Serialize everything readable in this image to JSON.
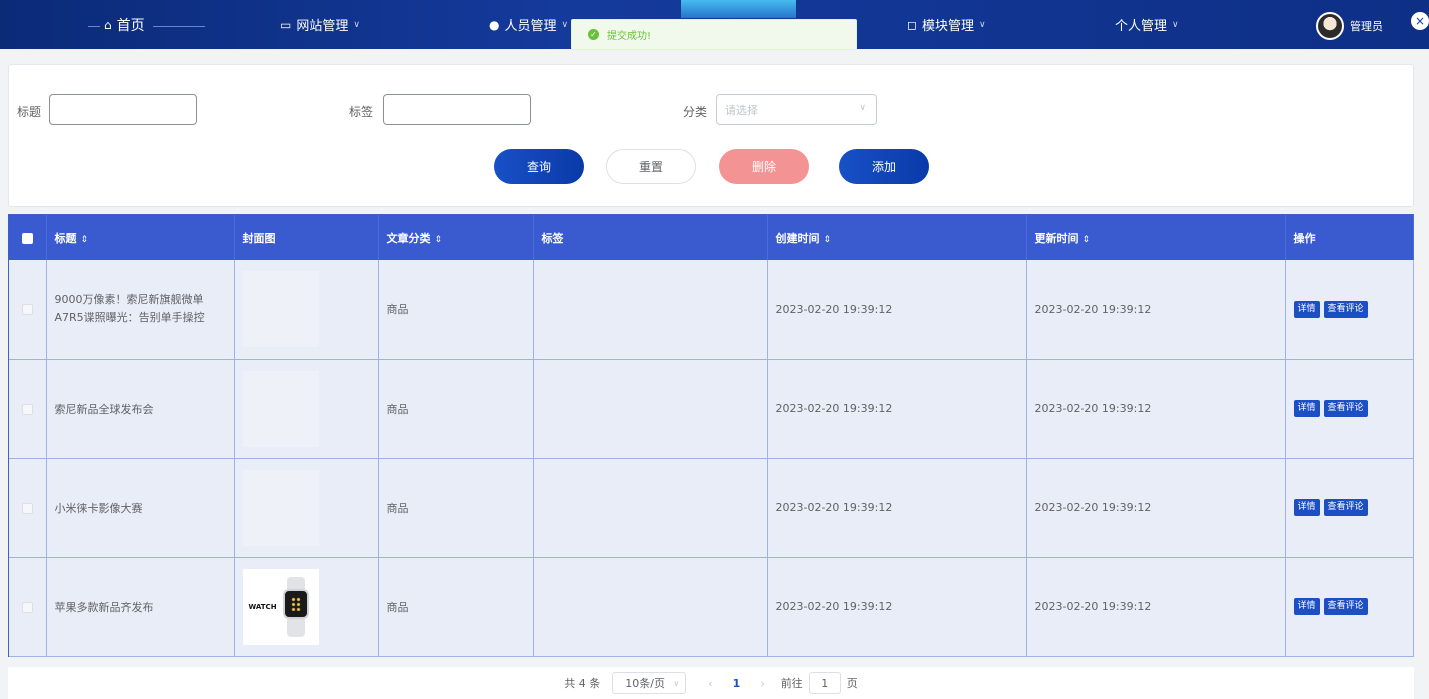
{
  "nav": {
    "home": "首页",
    "site_mgmt": "网站管理",
    "user_mgmt": "人员管理",
    "module_mgmt": "模块管理",
    "personal_mgmt": "个人管理",
    "admin": "管理员"
  },
  "toast": {
    "message": "提交成功!"
  },
  "search": {
    "title_label": "标题",
    "tag_label": "标签",
    "category_label": "分类",
    "category_placeholder": "请选择",
    "btn_query": "查询",
    "btn_reset": "重置",
    "btn_delete": "删除",
    "btn_add": "添加"
  },
  "table": {
    "headers": {
      "title": "标题",
      "cover": "封面图",
      "category": "文章分类",
      "tags": "标签",
      "created": "创建时间",
      "updated": "更新时间",
      "actions": "操作"
    },
    "rows": [
      {
        "title": "9000万像素！索尼新旗舰微单A7R5谍照曝光：告别单手操控",
        "category": "商品",
        "tags": "",
        "created": "2023-02-20 19:39:12",
        "updated": "2023-02-20 19:39:12"
      },
      {
        "title": "索尼新品全球发布会",
        "category": "商品",
        "tags": "",
        "created": "2023-02-20 19:39:12",
        "updated": "2023-02-20 19:39:12"
      },
      {
        "title": "小米徕卡影像大赛",
        "category": "商品",
        "tags": "",
        "created": "2023-02-20 19:39:12",
        "updated": "2023-02-20 19:39:12"
      },
      {
        "title": "苹果多款新品齐发布",
        "category": "商品",
        "tags": "",
        "created": "2023-02-20 19:39:12",
        "updated": "2023-02-20 19:39:12",
        "cover_text": "WATCH"
      }
    ],
    "btn_detail": "详情",
    "btn_comments": "查看评论"
  },
  "pager": {
    "total": "共 4 条",
    "page_size": "10条/页",
    "current": "1",
    "goto_prefix": "前往",
    "goto_value": "1",
    "goto_suffix": "页"
  }
}
